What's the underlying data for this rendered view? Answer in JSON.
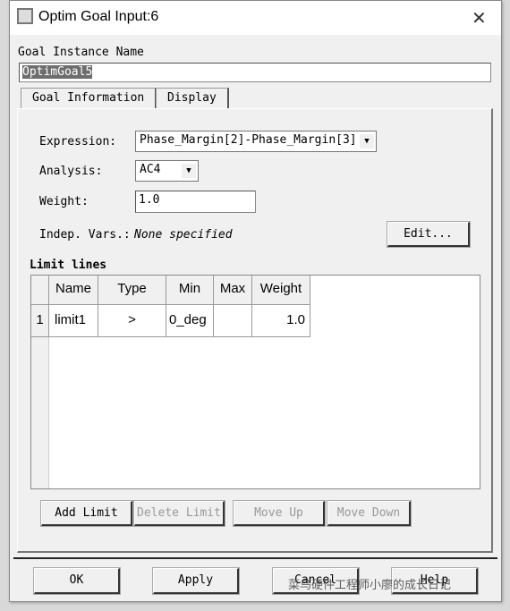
{
  "window": {
    "title": "Optim Goal Input:6",
    "close": "✕"
  },
  "goal_instance": {
    "label": "Goal Instance Name",
    "value": "OptimGoal5"
  },
  "tabs": [
    {
      "label": "Goal Information",
      "active": true
    },
    {
      "label": "Display",
      "active": false
    }
  ],
  "form": {
    "expression_label": "Expression:",
    "expression_value": "Phase_Margin[2]-Phase_Margin[3]",
    "analysis_label": "Analysis:",
    "analysis_value": "AC4",
    "weight_label": "Weight:",
    "weight_value": "1.0",
    "indep_label": "Indep. Vars.:",
    "indep_value": "None specified",
    "edit_label": "Edit..."
  },
  "limit_lines": {
    "title": "Limit lines",
    "columns": [
      "Name",
      "Type",
      "Min",
      "Max",
      "Weight"
    ],
    "rows": [
      {
        "index": "1",
        "name": "limit1",
        "type": ">",
        "min": "0_deg",
        "max": "",
        "weight": "1.0"
      }
    ]
  },
  "limit_buttons": {
    "add": "Add Limit",
    "delete": "Delete Limit",
    "move_up": "Move Up",
    "move_down": "Move Down"
  },
  "footer": {
    "ok": "OK",
    "apply": "Apply",
    "cancel": "Cancel",
    "help": "Help"
  },
  "watermark": "菜鸟硬件工程师小廖的成长日记"
}
